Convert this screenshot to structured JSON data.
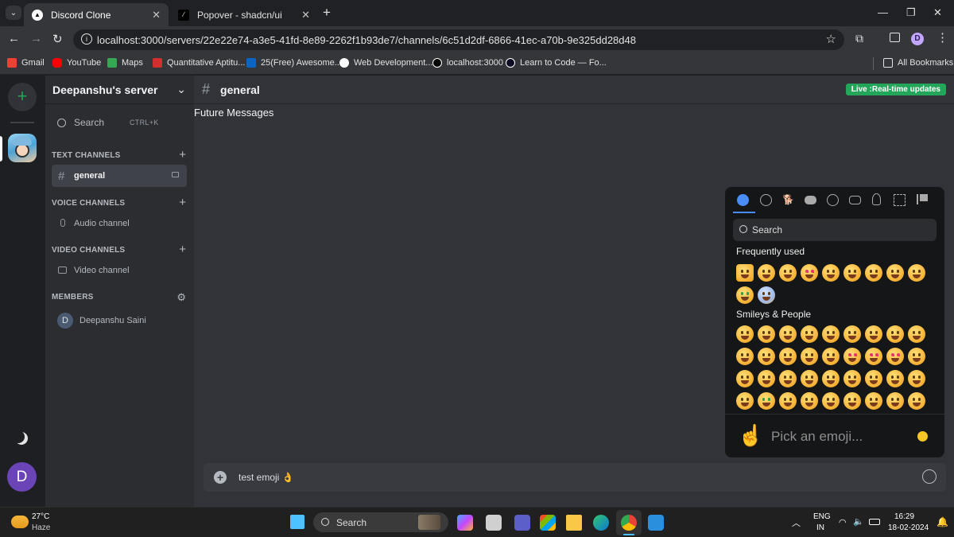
{
  "browser": {
    "tabs": [
      {
        "title": "Discord Clone",
        "active": true
      },
      {
        "title": "Popover - shadcn/ui",
        "active": false
      }
    ],
    "url": "localhost:3000/servers/22e22e74-a3e5-41fd-8e89-2262f1b93de7/channels/6c51d2df-6866-41ec-a70b-9e325dd28d48",
    "profile_initial": "D",
    "bookmarks": [
      "Gmail",
      "YouTube",
      "Maps",
      "Quantitative Aptitu...",
      "25(Free) Awesome...",
      "Web Development...",
      "localhost:3000",
      "Learn to Code — Fo..."
    ],
    "all_bookmarks_label": "All Bookmarks"
  },
  "rail": {
    "user_initial": "D"
  },
  "sidebar": {
    "server_name": "Deepanshu's server",
    "search_label": "Search",
    "search_shortcut": "CTRL+K",
    "sections": {
      "text": "TEXT CHANNELS",
      "voice": "VOICE CHANNELS",
      "video": "VIDEO CHANNELS",
      "members": "MEMBERS"
    },
    "channels": {
      "text": "general",
      "voice": "Audio channel",
      "video": "Video channel"
    },
    "member": {
      "initial": "D",
      "name": "Deepanshu Saini"
    }
  },
  "chat": {
    "channel_name": "general",
    "live_badge": "Live :Real-time updates",
    "future_messages": "Future Messages",
    "input_value": "test emoji  👌"
  },
  "emoji_picker": {
    "search_placeholder": "Search",
    "frequently_used_label": "Frequently used",
    "smileys_label": "Smileys & People",
    "footer_prompt": "Pick an emoji...",
    "footer_hand": "☝️"
  },
  "taskbar": {
    "weather_temp": "27°C",
    "weather_desc": "Haze",
    "search_label": "Search",
    "lang_top": "ENG",
    "lang_bottom": "IN",
    "time": "16:29",
    "date": "18-02-2024"
  },
  "colors": {
    "accent_green": "#23a55a",
    "brand_purple": "#6b45b8",
    "picker_active": "#4b8df8"
  }
}
